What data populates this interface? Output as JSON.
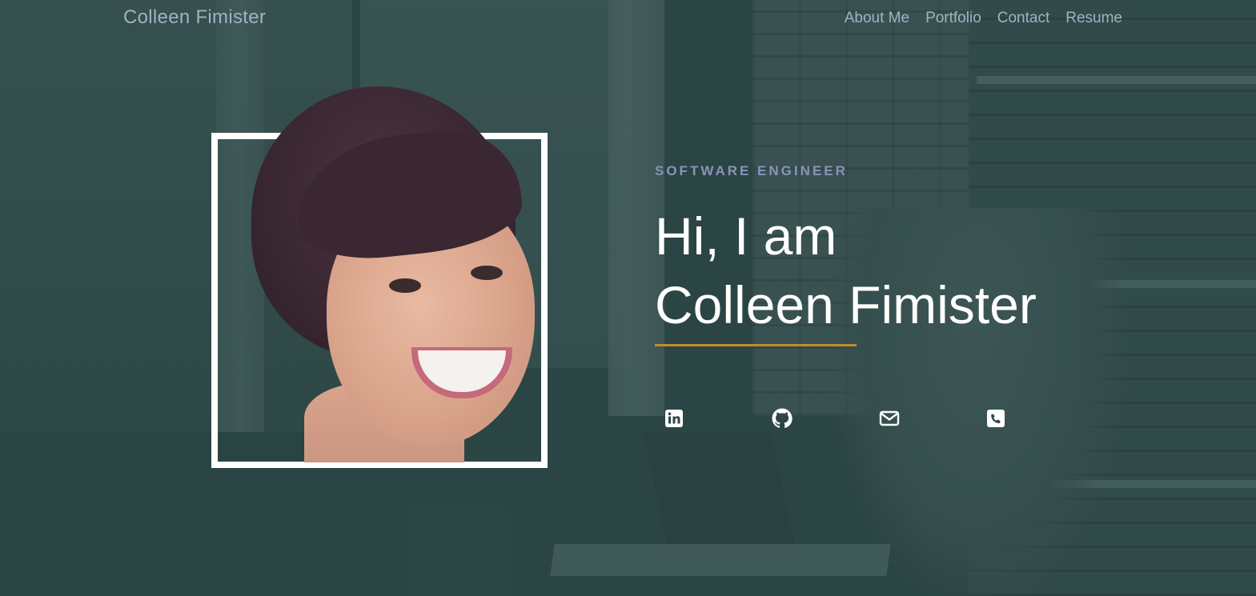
{
  "nav": {
    "brand": "Colleen Fimister",
    "links": [
      {
        "label": "About Me"
      },
      {
        "label": "Portfolio"
      },
      {
        "label": "Contact"
      },
      {
        "label": "Resume"
      }
    ]
  },
  "hero": {
    "subtitle": "SOFTWARE ENGINEER",
    "headline_line1": "Hi, I am",
    "headline_line2": "Colleen Fimister",
    "accent_color": "#c48a34"
  },
  "social_links": [
    {
      "icon": "linkedin-icon"
    },
    {
      "icon": "github-icon"
    },
    {
      "icon": "email-icon"
    },
    {
      "icon": "phone-icon"
    }
  ],
  "colors": {
    "background": "#2f4847",
    "nav_text": "#a3b1c4",
    "subtitle": "#8b93b8",
    "headline": "#ffffff"
  }
}
